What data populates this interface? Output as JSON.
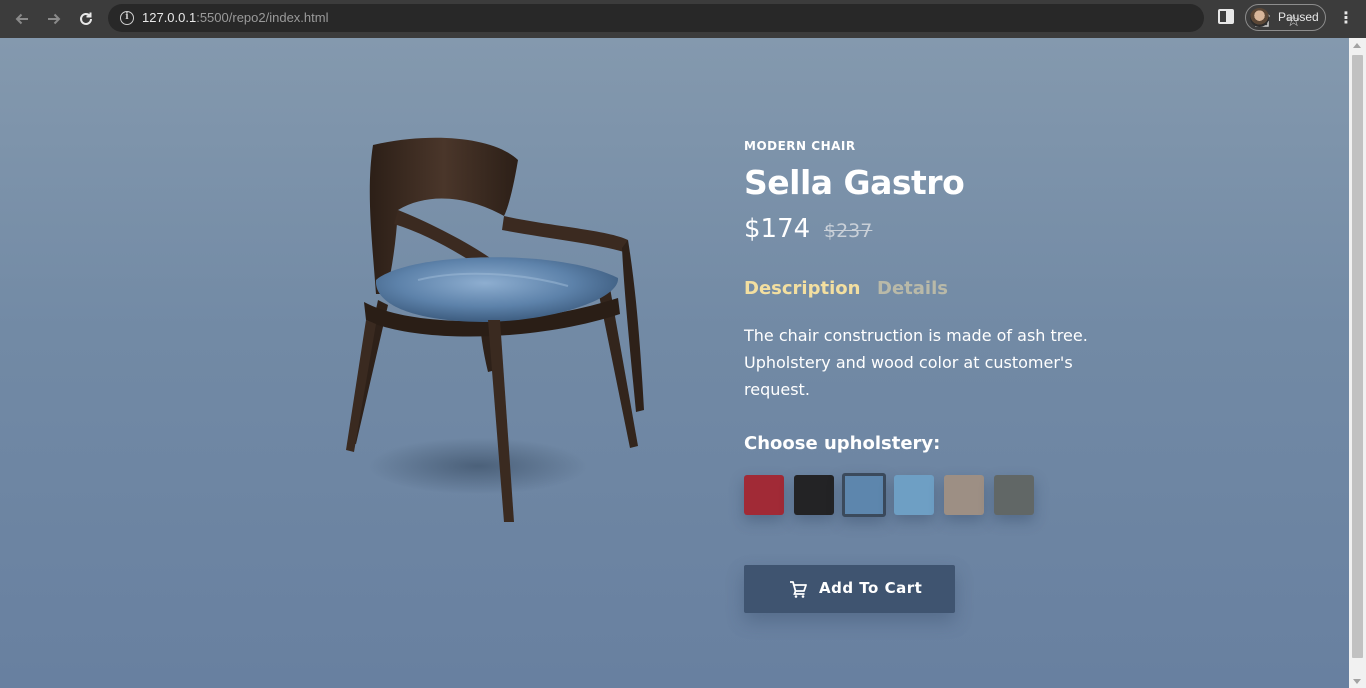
{
  "browser": {
    "url_host": "127.0.0.1",
    "url_rest": ":5500/repo2/index.html",
    "profile_label": "Paused",
    "icons": [
      "back-arrow-icon",
      "forward-arrow-icon",
      "reload-icon",
      "info-icon",
      "share-icon",
      "star-icon",
      "side-panel-icon",
      "menu-icon"
    ]
  },
  "product": {
    "eyebrow": "MODERN CHAIR",
    "title": "Sella Gastro",
    "price": "$174",
    "old_price": "$237",
    "tabs": [
      {
        "label": "Description",
        "active": true
      },
      {
        "label": "Details",
        "active": false
      }
    ],
    "description": "The chair construction is made of ash tree. Upholstery and wood color at customer's request.",
    "choose_label": "Choose upholstery:",
    "upholstery": [
      {
        "color": "#a12a36",
        "selected": false
      },
      {
        "color": "#232325",
        "selected": false
      },
      {
        "color": "#5d86ad",
        "selected": true
      },
      {
        "color": "#6e9fc4",
        "selected": false
      },
      {
        "color": "#9d8f84",
        "selected": false
      },
      {
        "color": "#616766",
        "selected": false
      }
    ],
    "cart_label": "Add To Cart",
    "colors": {
      "accent_tab": "#f3dfa0",
      "button": "#3f5470",
      "wood": "#3e2d22"
    }
  }
}
